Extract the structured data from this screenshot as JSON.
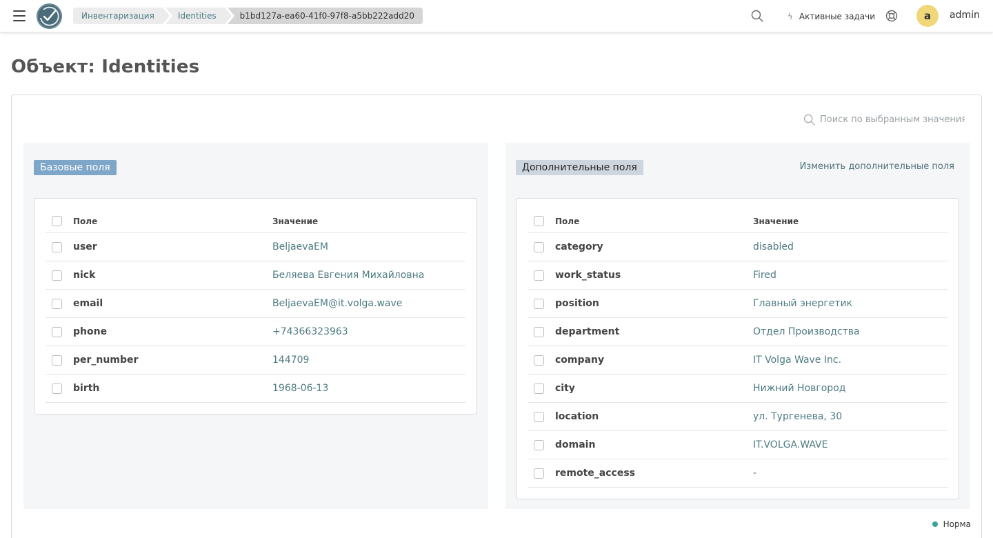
{
  "header": {
    "breadcrumb": [
      "Инвентаризация",
      "Identities",
      "b1bd127a-ea60-41f0-97f8-a5bb222add20"
    ],
    "active_tasks_label": "Активные задачи",
    "avatar_letter": "a",
    "username": "admin"
  },
  "page": {
    "title": "Объект: Identities",
    "search_placeholder": "Поиск по выбранным значениям"
  },
  "base_fields": {
    "tag": "Базовые поля",
    "col_field": "Поле",
    "col_value": "Значение",
    "rows": [
      {
        "field": "user",
        "value": "BeljaevaEM"
      },
      {
        "field": "nick",
        "value": "Беляева Евгения Михайловна"
      },
      {
        "field": "email",
        "value": "BeljaevaEM@it.volga.wave"
      },
      {
        "field": "phone",
        "value": "+74366323963"
      },
      {
        "field": "per_number",
        "value": "144709"
      },
      {
        "field": "birth",
        "value": "1968-06-13"
      }
    ]
  },
  "extra_fields": {
    "tag": "Дополнительные поля",
    "edit_label": "Изменить дополнительные поля",
    "col_field": "Поле",
    "col_value": "Значение",
    "rows": [
      {
        "field": "category",
        "value": "disabled"
      },
      {
        "field": "work_status",
        "value": "Fired"
      },
      {
        "field": "position",
        "value": "Главный энергетик"
      },
      {
        "field": "department",
        "value": "Отдел Производства"
      },
      {
        "field": "company",
        "value": "IT Volga Wave Inc."
      },
      {
        "field": "city",
        "value": "Нижний Новгород"
      },
      {
        "field": "location",
        "value": "ул. Тургенева, 30"
      },
      {
        "field": "domain",
        "value": "IT.VOLGA.WAVE"
      },
      {
        "field": "remote_access",
        "value": "-"
      }
    ]
  },
  "status": {
    "label": "Норма",
    "color": "#3aa39a"
  },
  "icons": {
    "menu": "hamburger-menu-icon",
    "logo": "check-circle-logo",
    "search": "search-icon",
    "bolt": "bolt-icon",
    "help": "lifebuoy-icon"
  }
}
